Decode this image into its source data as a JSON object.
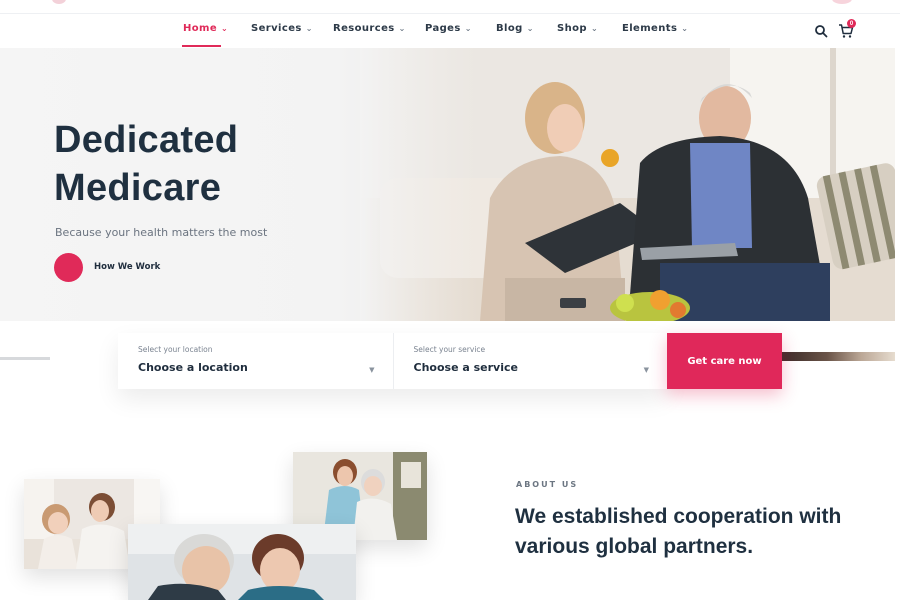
{
  "nav": {
    "items": [
      {
        "label": "Home",
        "active": true
      },
      {
        "label": "Services"
      },
      {
        "label": "Resources"
      },
      {
        "label": "Pages"
      },
      {
        "label": "Blog"
      },
      {
        "label": "Shop"
      },
      {
        "label": "Elements"
      }
    ],
    "cart_count": "0"
  },
  "hero": {
    "title_line1": "Dedicated",
    "title_line2": "Medicare",
    "subtitle": "Because your health matters the most",
    "cta_label": "How We Work"
  },
  "search": {
    "location_label": "Select your location",
    "location_value": "Choose a location",
    "service_label": "Select your service",
    "service_value": "Choose a service",
    "button_label": "Get care now"
  },
  "about": {
    "eyebrow": "ABOUT US",
    "title": "We established cooperation with various global partners."
  },
  "colors": {
    "accent": "#e02a59",
    "heading": "#1f3040",
    "text_muted": "#6b7480"
  }
}
